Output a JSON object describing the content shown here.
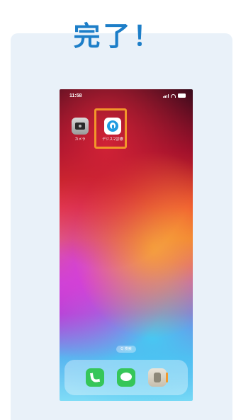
{
  "header": {
    "title": "完了！"
  },
  "phone": {
    "status_time": "11:58",
    "apps": [
      {
        "label": "カメラ",
        "icon": "camera-icon"
      },
      {
        "label": "デジスマ診療",
        "icon": "digisma-app-icon"
      }
    ],
    "search_label": "Q 検索",
    "dock": [
      {
        "icon": "phone-icon"
      },
      {
        "icon": "messages-icon"
      },
      {
        "icon": "contacts-icon"
      }
    ]
  },
  "colors": {
    "title": "#1d7ec8",
    "card_background": "#e9f1f9",
    "highlight": "#f2962a"
  }
}
